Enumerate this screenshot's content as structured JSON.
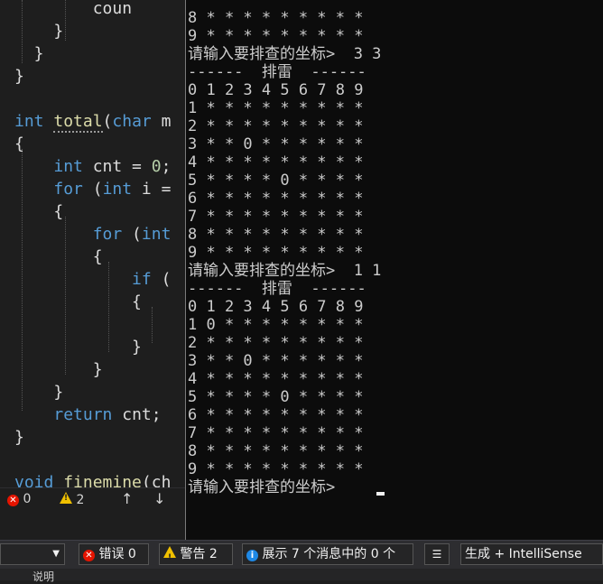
{
  "editor": {
    "lines": [
      [
        {
          "t": "        ",
          "c": "plain"
        },
        {
          "t": "coun",
          "c": "plain"
        }
      ],
      [
        {
          "t": "    }",
          "c": "plain"
        }
      ],
      [
        {
          "t": "  }",
          "c": "plain"
        }
      ],
      [
        {
          "t": "}",
          "c": "plain"
        }
      ],
      [],
      [
        {
          "t": "int",
          "c": "kw"
        },
        {
          "t": " ",
          "c": "plain"
        },
        {
          "t": "total",
          "c": "fn"
        },
        {
          "t": "(",
          "c": "plain"
        },
        {
          "t": "char",
          "c": "kw"
        },
        {
          "t": " m",
          "c": "plain"
        }
      ],
      [
        {
          "t": "{",
          "c": "plain"
        }
      ],
      [
        {
          "t": "    ",
          "c": "plain"
        },
        {
          "t": "int",
          "c": "kw"
        },
        {
          "t": " cnt = ",
          "c": "plain"
        },
        {
          "t": "0",
          "c": "num"
        },
        {
          "t": ";",
          "c": "plain"
        }
      ],
      [
        {
          "t": "    ",
          "c": "plain"
        },
        {
          "t": "for",
          "c": "kw"
        },
        {
          "t": " (",
          "c": "plain"
        },
        {
          "t": "int",
          "c": "kw"
        },
        {
          "t": " i =",
          "c": "plain"
        }
      ],
      [
        {
          "t": "    {",
          "c": "plain"
        }
      ],
      [
        {
          "t": "        ",
          "c": "plain"
        },
        {
          "t": "for",
          "c": "kw"
        },
        {
          "t": " (",
          "c": "plain"
        },
        {
          "t": "int",
          "c": "kw"
        }
      ],
      [
        {
          "t": "        {",
          "c": "plain"
        }
      ],
      [
        {
          "t": "            ",
          "c": "plain"
        },
        {
          "t": "if",
          "c": "kw"
        },
        {
          "t": " (",
          "c": "plain"
        }
      ],
      [
        {
          "t": "            {",
          "c": "plain"
        }
      ],
      [],
      [
        {
          "t": "            }",
          "c": "plain"
        }
      ],
      [
        {
          "t": "        }",
          "c": "plain"
        }
      ],
      [
        {
          "t": "    }",
          "c": "plain"
        }
      ],
      [
        {
          "t": "    ",
          "c": "plain"
        },
        {
          "t": "return",
          "c": "kw"
        },
        {
          "t": " cnt;",
          "c": "plain"
        }
      ],
      [
        {
          "t": "}",
          "c": "plain"
        }
      ],
      [],
      [
        {
          "t": "void",
          "c": "kw"
        },
        {
          "t": " ",
          "c": "plain"
        },
        {
          "t": "finemine",
          "c": "fn"
        },
        {
          "t": "(ch",
          "c": "plain"
        }
      ]
    ]
  },
  "editor_info": {
    "errors": "0",
    "warnings": "2",
    "up_arrow": "↑",
    "down_arrow": "↓"
  },
  "error_list": {
    "errors_label": "错误 0",
    "warnings_label": "警告 2",
    "messages_label": "展示 7 个消息中的 0 个",
    "build_filter": "生成 + IntelliSense",
    "column_header": "说明"
  },
  "console": {
    "lines": [
      "8 * * * * * * * * *",
      "9 * * * * * * * * *",
      "请输入要排查的坐标>  3 3",
      "------  排雷  ------",
      "0 1 2 3 4 5 6 7 8 9",
      "1 * * * * * * * * *",
      "2 * * * * * * * * *",
      "3 * * 0 * * * * * *",
      "4 * * * * * * * * *",
      "5 * * * * 0 * * * *",
      "6 * * * * * * * * *",
      "7 * * * * * * * * *",
      "8 * * * * * * * * *",
      "9 * * * * * * * * *",
      "请输入要排查的坐标>  1 1",
      "------  排雷  ------",
      "0 1 2 3 4 5 6 7 8 9",
      "1 0 * * * * * * * *",
      "2 * * * * * * * * *",
      "3 * * 0 * * * * * *",
      "4 * * * * * * * * *",
      "5 * * * * 0 * * * *",
      "6 * * * * * * * * *",
      "7 * * * * * * * * *",
      "8 * * * * * * * * *",
      "9 * * * * * * * * *",
      "请输入要排查的坐标>"
    ]
  }
}
